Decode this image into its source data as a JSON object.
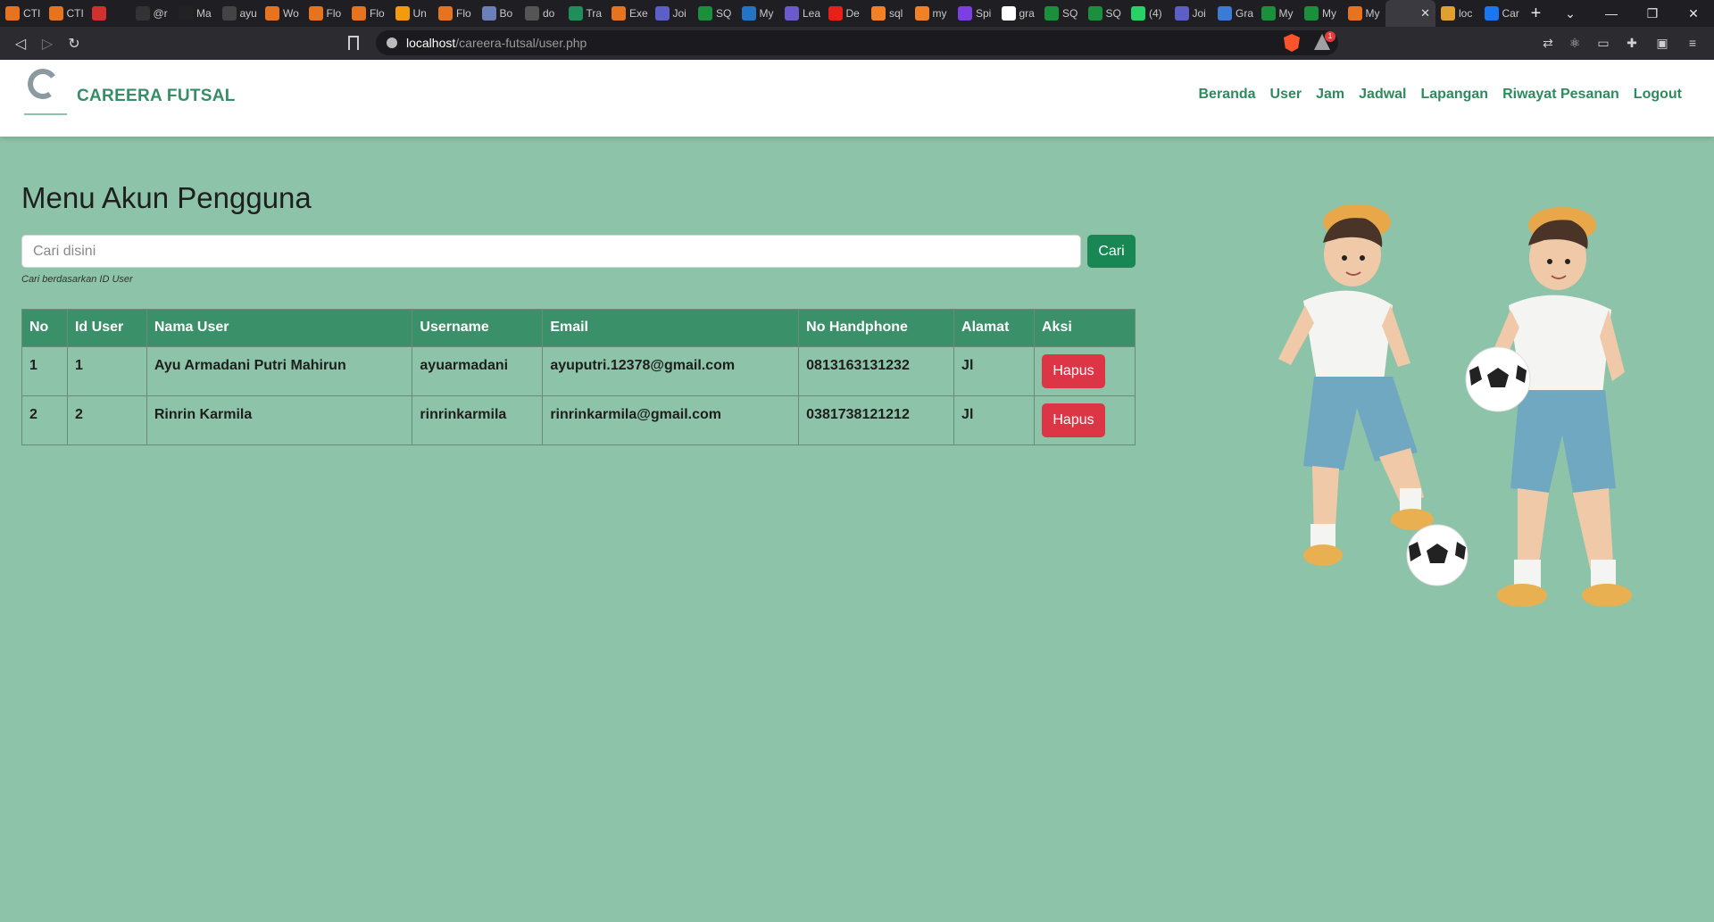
{
  "browser": {
    "tabs": [
      {
        "label": "CTI",
        "color": "#e8731e"
      },
      {
        "label": "CTI",
        "color": "#e8731e"
      },
      {
        "label": "",
        "color": "#d32f2f"
      },
      {
        "label": "@r",
        "color": "#333333"
      },
      {
        "label": "Ma",
        "color": "#222222"
      },
      {
        "label": "ayu",
        "color": "#444444"
      },
      {
        "label": "Wo",
        "color": "#e8731e"
      },
      {
        "label": "Flo",
        "color": "#e8731e"
      },
      {
        "label": "Flo",
        "color": "#e8731e"
      },
      {
        "label": "Un",
        "color": "#f59a0a"
      },
      {
        "label": "Flo",
        "color": "#e8731e"
      },
      {
        "label": "Bo",
        "color": "#6b7fb8"
      },
      {
        "label": "do",
        "color": "#555555"
      },
      {
        "label": "Tra",
        "color": "#1e8e5a"
      },
      {
        "label": "Exe",
        "color": "#e8731e"
      },
      {
        "label": "Joi",
        "color": "#5b5fc7"
      },
      {
        "label": "SQ",
        "color": "#1a8f3c"
      },
      {
        "label": "My",
        "color": "#2274c4"
      },
      {
        "label": "Lea",
        "color": "#6a5acd"
      },
      {
        "label": "De",
        "color": "#e62117"
      },
      {
        "label": "sql",
        "color": "#f48024"
      },
      {
        "label": "my",
        "color": "#f48024"
      },
      {
        "label": "Spi",
        "color": "#7b3fe4"
      },
      {
        "label": "gra",
        "color": "#ffffff"
      },
      {
        "label": "SQ",
        "color": "#1a8f3c"
      },
      {
        "label": "SQ",
        "color": "#1a8f3c"
      },
      {
        "label": "(4)",
        "color": "#25d366"
      },
      {
        "label": "Joi",
        "color": "#5b5fc7"
      },
      {
        "label": "Gra",
        "color": "#3b7bd6"
      },
      {
        "label": "My",
        "color": "#1a8f3c"
      },
      {
        "label": "My",
        "color": "#1a8f3c"
      },
      {
        "label": "My",
        "color": "#e8731e"
      },
      {
        "label": "",
        "color": "#3a3a40"
      },
      {
        "label": "loc",
        "color": "#e0a030"
      },
      {
        "label": "Car",
        "color": "#1877f2"
      }
    ],
    "url_host": "localhost",
    "url_path": "/careera-futsal/user.php",
    "brave_badge": "1"
  },
  "navbar": {
    "brand": "CAREERA FUTSAL",
    "menu": [
      "Beranda",
      "User",
      "Jam",
      "Jadwal",
      "Lapangan",
      "Riwayat Pesanan",
      "Logout"
    ]
  },
  "main": {
    "title": "Menu Akun Pengguna",
    "search_placeholder": "Cari disini",
    "search_button": "Cari",
    "search_hint": "Cari berdasarkan ID User",
    "table": {
      "headers": [
        "No",
        "Id User",
        "Nama User",
        "Username",
        "Email",
        "No Handphone",
        "Alamat",
        "Aksi"
      ],
      "rows": [
        {
          "no": "1",
          "id": "1",
          "nama": "Ayu Armadani Putri Mahirun",
          "username": "ayuarmadani",
          "email": "ayuputri.12378@gmail.com",
          "hp": "0813163131232",
          "alamat": "Jl",
          "aksi": "Hapus"
        },
        {
          "no": "2",
          "id": "2",
          "nama": "Rinrin Karmila",
          "username": "rinrinkarmila",
          "email": "rinrinkarmila@gmail.com",
          "hp": "0381738121212",
          "alamat": "Jl",
          "aksi": "Hapus"
        }
      ]
    }
  },
  "colors": {
    "page_bg": "#8dc3a8",
    "accent_green": "#198754",
    "table_header": "#3a9068",
    "danger": "#dc3545"
  }
}
